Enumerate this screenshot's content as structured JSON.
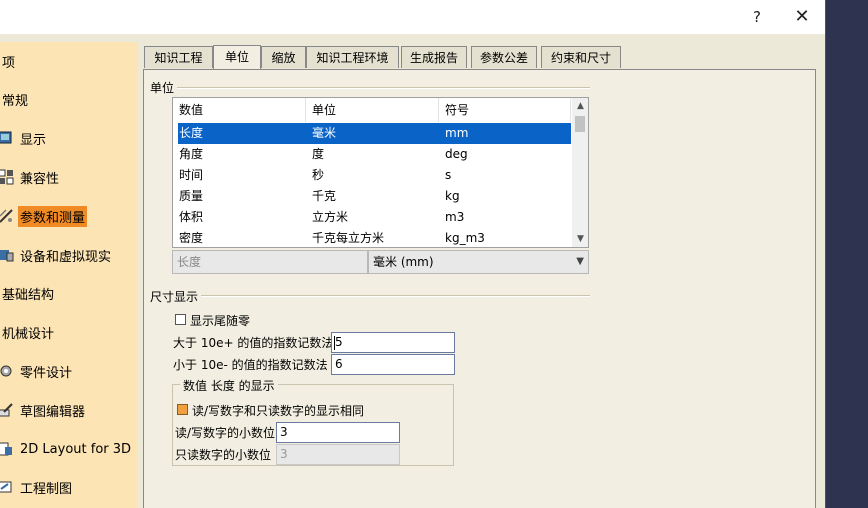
{
  "window": {
    "help_glyph": "?",
    "close_glyph": "✕"
  },
  "sidebar": {
    "items": [
      {
        "label": "项",
        "icon": "none-icon"
      },
      {
        "label": "常规",
        "icon": "none-icon"
      },
      {
        "label": "显示",
        "icon": "display-icon"
      },
      {
        "label": "兼容性",
        "icon": "compatibility-icon"
      },
      {
        "label": "参数和测量",
        "icon": "parameters-icon",
        "selected": true
      },
      {
        "label": "设备和虚拟现实",
        "icon": "devices-icon"
      },
      {
        "label": "基础结构",
        "icon": "none-icon"
      },
      {
        "label": "机械设计",
        "icon": "none-icon"
      },
      {
        "label": "零件设计",
        "icon": "part-design-icon"
      },
      {
        "label": "草图编辑器",
        "icon": "sketcher-icon"
      },
      {
        "label": "2D Layout for 3D",
        "icon": "layout-2d-icon"
      },
      {
        "label": "工程制图",
        "icon": "drafting-icon"
      }
    ]
  },
  "tabs": [
    "知识工程",
    "单位",
    "缩放",
    "知识工程环境",
    "生成报告",
    "参数公差",
    "约束和尺寸"
  ],
  "active_tab": "单位",
  "units_group": {
    "title": "单位",
    "columns": [
      "数值",
      "单位",
      "符号"
    ],
    "rows": [
      {
        "name": "长度",
        "unit": "毫米",
        "symbol": "mm"
      },
      {
        "name": "角度",
        "unit": "度",
        "symbol": "deg"
      },
      {
        "name": "时间",
        "unit": "秒",
        "symbol": "s"
      },
      {
        "name": "质量",
        "unit": "千克",
        "symbol": "kg"
      },
      {
        "name": "体积",
        "unit": "立方米",
        "symbol": "m3"
      },
      {
        "name": "密度",
        "unit": "千克每立方米",
        "symbol": "kg_m3"
      }
    ],
    "selected_label": "长度",
    "selected_unit": "毫米 (mm)"
  },
  "dimension_group": {
    "title": "尺寸显示",
    "trailing_zeros_label": "显示尾随零",
    "trailing_zeros_checked": false,
    "exp_above_label": "大于 10e+ 的值的指数记数法",
    "exp_above_value": "5",
    "exp_below_label": "小于 10e- 的值的指数记数法",
    "exp_below_value": "6",
    "length_display": {
      "title": "数值 长度 的显示",
      "same_display_label": "读/写数字和只读数字的显示相同",
      "same_display_checked": true,
      "rw_decimals_label": "读/写数字的小数位",
      "rw_decimals_value": "3",
      "ro_decimals_label": "只读数字的小数位",
      "ro_decimals_value": "3"
    }
  }
}
